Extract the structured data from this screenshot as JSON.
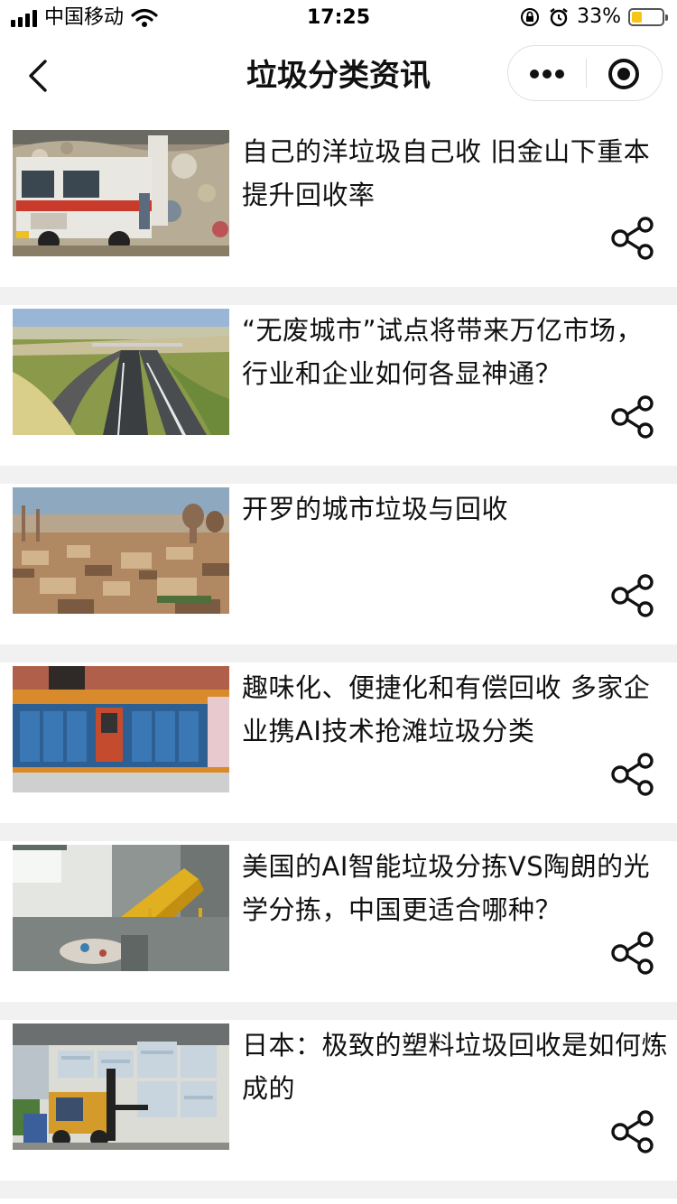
{
  "status_bar": {
    "carrier": "中国移动",
    "time": "17:25",
    "battery_percent": "33%",
    "battery_level": 0.33,
    "icons": [
      "signal-icon",
      "wifi-icon",
      "lock-rotation-icon",
      "alarm-icon",
      "battery-icon"
    ]
  },
  "nav": {
    "title": "垃圾分类资讯",
    "icons": [
      "back-chevron-icon",
      "more-dots-icon",
      "close-target-icon"
    ]
  },
  "articles": [
    {
      "title": "自己的洋垃圾自己收 旧金山下重本提升回收率",
      "thumbnail": "garbage-truck-landfill",
      "action_icon": "share-icon"
    },
    {
      "title": "“无废城市”试点将带来万亿市场，行业和企业如何各显神通？",
      "thumbnail": "highway-aerial",
      "action_icon": "share-icon"
    },
    {
      "title": "开罗的城市垃圾与回收",
      "thumbnail": "cairo-cityscape",
      "action_icon": "share-icon"
    },
    {
      "title": "趣味化、便捷化和有偿回收 多家企业携AI技术抢滩垃圾分类",
      "thumbnail": "smart-recycling-bins",
      "action_icon": "share-icon"
    },
    {
      "title": "美国的AI智能垃圾分拣VS陶朗的光学分拣，中国更适合哪种？",
      "thumbnail": "sorting-facility-conveyor",
      "action_icon": "share-icon"
    },
    {
      "title": "日本：极致的塑料垃圾回收是如何炼成的",
      "thumbnail": "forklift-plastic-bales",
      "action_icon": "share-icon"
    }
  ],
  "colors": {
    "divider": "#f1f1f1",
    "text": "#111111",
    "battery_fill": "#f5c518"
  }
}
